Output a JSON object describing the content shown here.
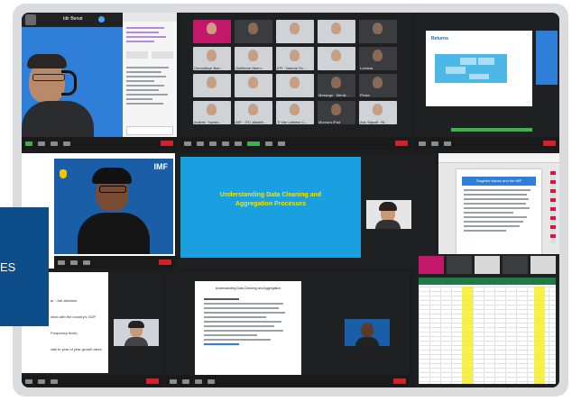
{
  "colors": {
    "frame": "#d9dbde",
    "meeting_bg": "#1c1d1f",
    "zoom_blue": "#2f7fd8",
    "imf_blue": "#1a5ea8",
    "slide_blue": "#1aa0e0",
    "slide_text": "#f2e500",
    "end_red": "#d0202a",
    "banner": "#0d4d8a",
    "excel_green": "#1f7a45",
    "excel_yellow": "#f7ef2a"
  },
  "banner": {
    "text": "ES"
  },
  "tl_window": {
    "speaker_name": "Idir Benat",
    "chat_lines": 14
  },
  "gallery": {
    "tiles": [
      {
        "name": "",
        "photo": "pink"
      },
      {
        "name": "",
        "photo": "dark"
      },
      {
        "name": "",
        "photo": "light"
      },
      {
        "name": "",
        "photo": "light"
      },
      {
        "name": "",
        "photo": "dark"
      },
      {
        "name": "Oumotifoye Ban...",
        "photo": "light"
      },
      {
        "name": "Gaëlleme Nkem...",
        "photo": "light"
      },
      {
        "name": "KPI · Namrai Su...",
        "photo": "light"
      },
      {
        "name": "",
        "photo": "light"
      },
      {
        "name": "Luhiana",
        "photo": "dark"
      },
      {
        "name": "",
        "photo": "light"
      },
      {
        "name": "",
        "photo": "light"
      },
      {
        "name": "",
        "photo": "light"
      },
      {
        "name": "Messege · Menik...",
        "photo": "dark"
      },
      {
        "name": "Pinton",
        "photo": "dark"
      },
      {
        "name": "Andres · Iseber...",
        "photo": "light"
      },
      {
        "name": "IMF · ITD Jakabh...",
        "photo": "light"
      },
      {
        "name": "Ti Vân Liebeke C...",
        "photo": "light"
      },
      {
        "name": "Monna's iPad",
        "photo": "dark"
      },
      {
        "name": "Adu Sapaff · Ni...",
        "photo": "light"
      }
    ]
  },
  "tr_window": {
    "slide_title": "Returns"
  },
  "center_slide": {
    "title_line1": "Understanding Data Cleaning and",
    "title_line2": "Aggregation Processes"
  },
  "mid_right_doc": {
    "title": "Targeted Issues and the IMF"
  },
  "imf_logo": "IMF",
  "bottom_left_doc": {
    "lines": [
      "ar : Job allotnew",
      "nlina with the country's GDP",
      "Frequency level)",
      "rate to year of year growth rates"
    ]
  },
  "bottom_mid_doc": {
    "heading": "Understanding Data Cleaning and Aggregation"
  }
}
